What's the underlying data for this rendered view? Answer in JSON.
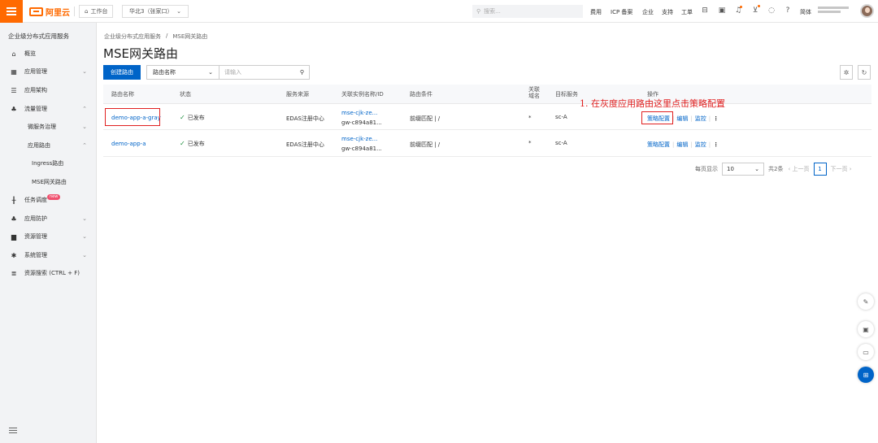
{
  "colors": {
    "brand": "#ff6a00",
    "primary": "#0064c8",
    "annotation": "#e02020",
    "success": "#1e8e3e"
  },
  "topbar": {
    "logo": "阿里云",
    "workbench": "工作台",
    "region": "华北3（张家口）",
    "search_placeholder": "搜索...",
    "links": [
      "费用",
      "ICP 备案",
      "企业",
      "支持",
      "工单"
    ],
    "lang": "简体",
    "icons": [
      "terminal-icon",
      "image-icon",
      "bell-icon",
      "cart-icon",
      "location-icon",
      "help-icon"
    ]
  },
  "sidebar": {
    "title": "企业级分布式应用服务",
    "items": [
      {
        "label": "概览",
        "icon": "home-icon"
      },
      {
        "label": "应用管理",
        "icon": "grid-icon",
        "expandable": true
      },
      {
        "label": "应用架构",
        "icon": "server-icon"
      },
      {
        "label": "流量管理",
        "icon": "flow-icon",
        "expanded": true
      },
      {
        "label": "微服务治理",
        "sub": true,
        "expandable": true
      },
      {
        "label": "应用路由",
        "sub": true,
        "expanded": true
      },
      {
        "label": "Ingress路由",
        "subsub": true
      },
      {
        "label": "MSE网关路由",
        "subsub": true,
        "active": true
      },
      {
        "label": "任务调度",
        "icon": "schedule-icon",
        "badge": "new"
      },
      {
        "label": "应用防护",
        "icon": "shield-icon",
        "expandable": true
      },
      {
        "label": "资源管理",
        "icon": "folder-icon",
        "expandable": true
      },
      {
        "label": "系统管理",
        "icon": "gear-icon",
        "expandable": true
      },
      {
        "label": "资源搜索 (CTRL + F)",
        "icon": "search-list-icon"
      }
    ]
  },
  "breadcrumb": [
    "企业级分布式应用服务",
    "/",
    "MSE网关路由"
  ],
  "page_title": "MSE网关路由",
  "toolbar": {
    "create_label": "创建路由",
    "filter_select": "路由名称",
    "filter_placeholder": "请输入"
  },
  "table": {
    "headers": [
      "路由名称",
      "状态",
      "服务来源",
      "关联实例名称/ID",
      "路由条件",
      "关联\n域名",
      "目标服务",
      "操作"
    ],
    "rows": [
      {
        "name": "demo-app-a-gray",
        "status": "已发布",
        "source": "EDAS注册中心",
        "instance_name": "mse-cjk-ze...",
        "instance_id": "gw-c894a81...",
        "condition": "前缀匹配 | /",
        "domain": "*",
        "target": "sc-A",
        "actions": [
          "策略配置",
          "编辑",
          "监控"
        ]
      },
      {
        "name": "demo-app-a",
        "status": "已发布",
        "source": "EDAS注册中心",
        "instance_name": "mse-cjk-ze...",
        "instance_id": "gw-c894a81...",
        "condition": "前缀匹配 | /",
        "domain": "*",
        "target": "sc-A",
        "actions": [
          "策略配置",
          "编辑",
          "监控"
        ]
      }
    ]
  },
  "annotation": "1. 在灰度应用路由这里点击策略配置",
  "pagination": {
    "per_page_label": "每页显示",
    "per_page": "10",
    "total": "共2条",
    "prev": "上一页",
    "current": "1",
    "next": "下一页"
  },
  "fabs": [
    "edit-icon",
    "record-icon",
    "message-icon",
    "apps-icon"
  ]
}
